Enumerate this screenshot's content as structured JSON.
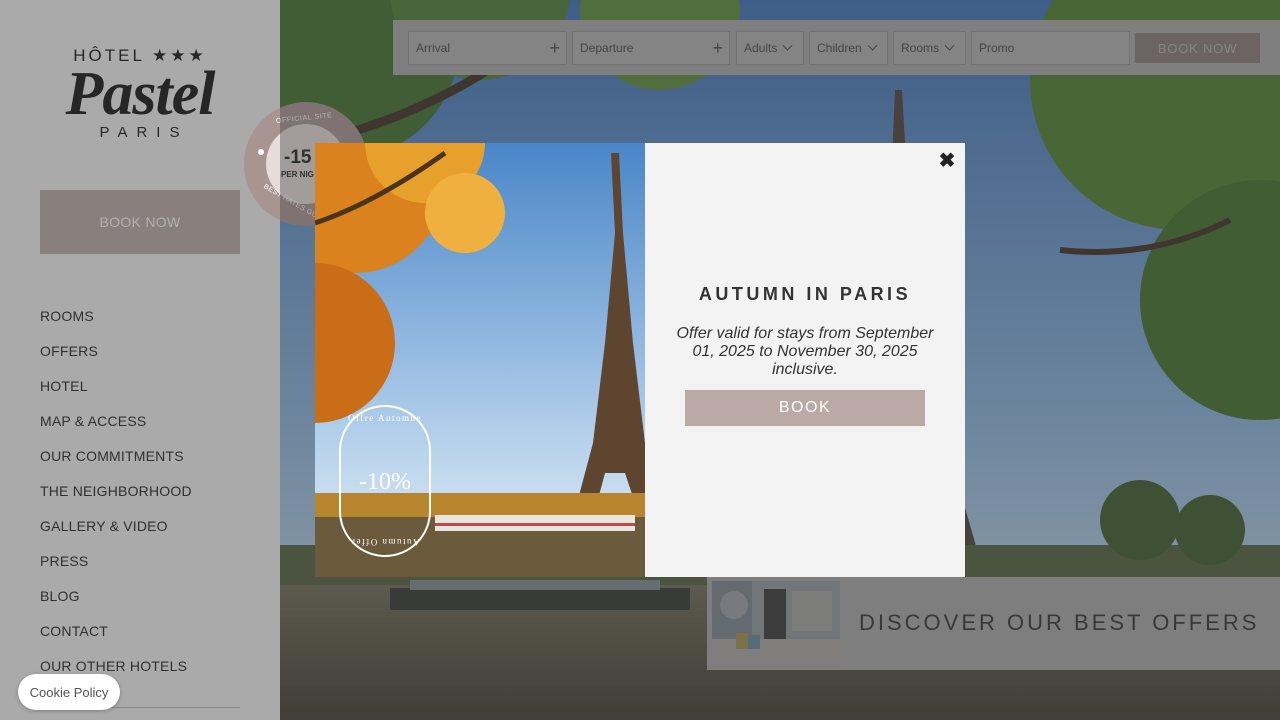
{
  "sidebar": {
    "logo": {
      "line1": "HÔTEL ★★★",
      "line2": "Pastel",
      "line3": "PARIS"
    },
    "book_label": "BOOK NOW",
    "nav": [
      "ROOMS",
      "OFFERS",
      "HOTEL",
      "MAP & ACCESS",
      "OUR COMMITMENTS",
      "THE NEIGHBORHOOD",
      "GALLERY & VIDEO",
      "PRESS",
      "BLOG",
      "CONTACT",
      "OUR OTHER HOTELS"
    ]
  },
  "badge": {
    "top_text": "OFFICIAL SITE",
    "value": "-15",
    "sub": "PER NIG",
    "bottom_text": "BEST RATES GU"
  },
  "booking_bar": {
    "arrival": "Arrival",
    "departure": "Departure",
    "adults": "Adults",
    "children": "Children",
    "rooms": "Rooms",
    "promo_placeholder": "Promo",
    "book_label": "BOOK NOW"
  },
  "modal": {
    "title": "AUTUMN IN PARIS",
    "text": "Offer valid for stays from September 01, 2025 to November 30, 2025 inclusive.",
    "book_label": "BOOK",
    "close_glyph": "✖",
    "promo": {
      "value": "-10%",
      "arc_top": "Offre Automne",
      "arc_bottom": "Autumn Offer"
    }
  },
  "offers_banner": {
    "title": "DISCOVER OUR BEST OFFERS"
  },
  "cookie": {
    "label": "Cookie Policy"
  },
  "colors": {
    "accent": "#bba9a6",
    "sidebar_bg": "#f3f3f3",
    "badge": "#a89592"
  }
}
